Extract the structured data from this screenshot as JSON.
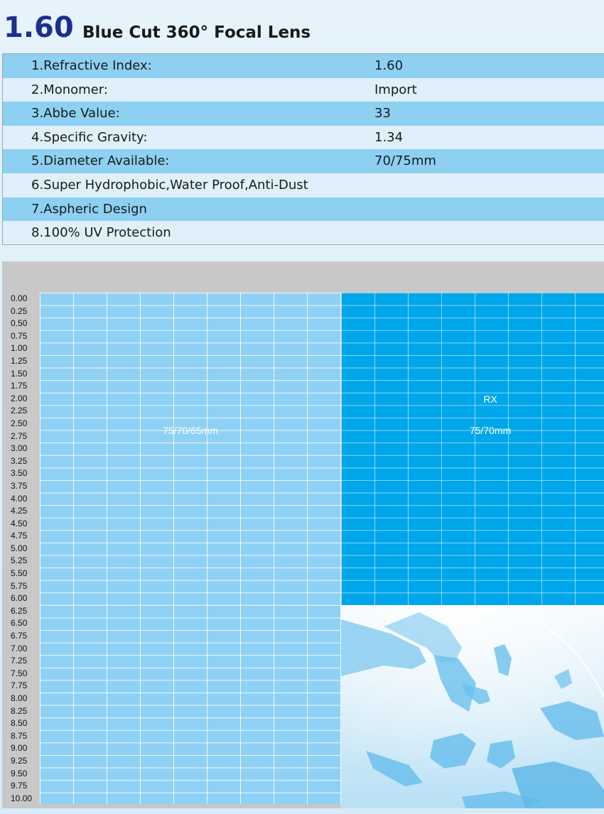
{
  "header": {
    "title_number": "1.60",
    "title_text": "Blue Cut 360° Focal Lens"
  },
  "specs": [
    {
      "label": "1.Refractive Index:",
      "value": "1.60"
    },
    {
      "label": "2.Monomer:",
      "value": "Import"
    },
    {
      "label": "3.Abbe Value:",
      "value": "33"
    },
    {
      "label": "4.Specific Gravity:",
      "value": "1.34"
    },
    {
      "label": "5.Diameter Available:",
      "value": "70/75mm"
    },
    {
      "label": "6.Super Hydrophobic,Water Proof,Anti-Dust",
      "value": ""
    },
    {
      "label": "7.Aspheric Design",
      "value": ""
    },
    {
      "label": "8.100% UV Protection",
      "value": ""
    }
  ],
  "range_chart": {
    "axis_values": [
      "0.00",
      "0.25",
      "0.50",
      "0.75",
      "1.00",
      "1.25",
      "1.50",
      "1.75",
      "2.00",
      "2.25",
      "2.50",
      "2.75",
      "3.00",
      "3.25",
      "3.50",
      "3.75",
      "4.00",
      "4.25",
      "4.50",
      "4.75",
      "5.00",
      "5.25",
      "5.50",
      "5.75",
      "6.00",
      "6.25",
      "6.50",
      "6.75",
      "7.00",
      "7.25",
      "7.50",
      "7.75",
      "8.00",
      "8.25",
      "8.50",
      "8.75",
      "9.00",
      "9.25",
      "9.50",
      "9.75",
      "10.00"
    ],
    "stock_label": "75/70/65mm",
    "stock_range": [
      0,
      10
    ],
    "rx_label": "RX",
    "rx_diameter": "75/70mm",
    "rx_range": [
      0,
      6
    ],
    "colors": {
      "stock": "#8fd1f4",
      "rx": "#00a6ea",
      "title": "#1c2f8f"
    }
  }
}
